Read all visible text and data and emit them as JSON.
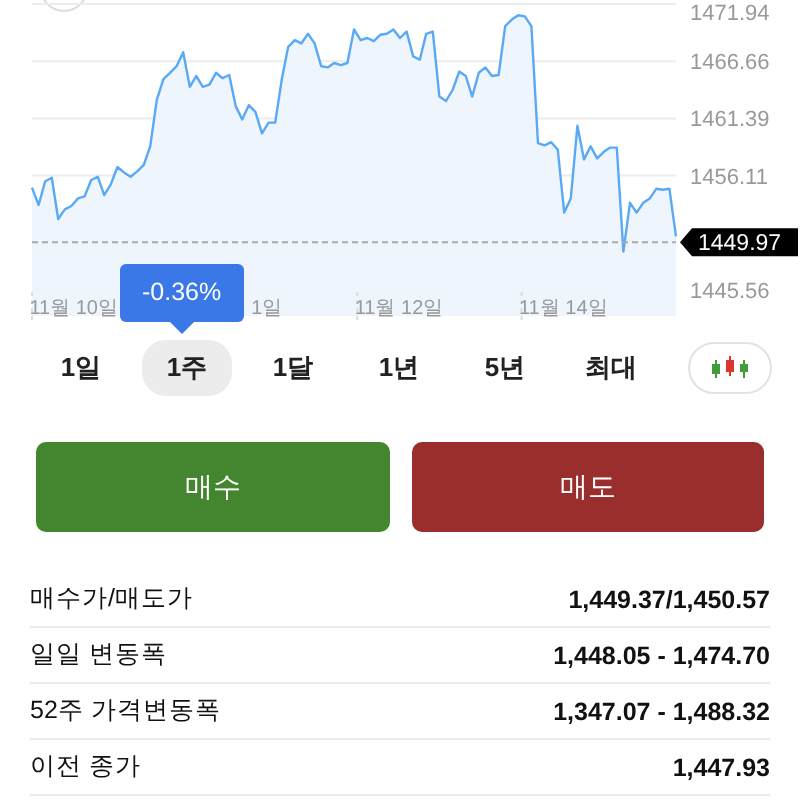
{
  "chart": {
    "tooltip": "-0.36%",
    "x_labels": [
      "11월 10일",
      "1일",
      "11월 12일",
      "11월 14일"
    ],
    "chart_data": {
      "type": "area",
      "grid": true,
      "series": [
        {
          "color": "#5aa9f5",
          "values": [
            1455.0,
            1453.4,
            1455.6,
            1455.9,
            1452.1,
            1453.0,
            1453.3,
            1454.0,
            1454.2,
            1455.7,
            1456.0,
            1454.3,
            1455.3,
            1456.9,
            1456.4,
            1456.0,
            1456.5,
            1457.1,
            1458.8,
            1463.1,
            1465.0,
            1465.6,
            1466.2,
            1467.5,
            1464.3,
            1465.3,
            1464.3,
            1464.5,
            1465.6,
            1465.1,
            1465.4,
            1462.5,
            1461.3,
            1462.6,
            1462.0,
            1460.0,
            1461.0,
            1461.0,
            1465.0,
            1468.0,
            1468.6,
            1468.3,
            1469.2,
            1468.3,
            1466.2,
            1466.1,
            1466.5,
            1466.3,
            1466.5,
            1469.6,
            1468.6,
            1468.8,
            1468.5,
            1469.1,
            1469.2,
            1469.6,
            1468.8,
            1469.4,
            1467.1,
            1466.8,
            1469.2,
            1469.4,
            1463.4,
            1463.0,
            1464.0,
            1465.7,
            1465.3,
            1463.4,
            1465.6,
            1466.1,
            1465.3,
            1465.4,
            1469.9,
            1470.5,
            1470.9,
            1470.8,
            1469.9,
            1459.1,
            1458.9,
            1459.2,
            1458.5,
            1452.7,
            1454.0,
            1460.7,
            1457.6,
            1458.8,
            1457.7,
            1458.3,
            1458.7,
            1458.7,
            1449.1,
            1453.6,
            1452.7,
            1453.6,
            1454.0,
            1454.9,
            1454.8,
            1454.9,
            1450.5
          ]
        }
      ],
      "ylim": [
        1445.56,
        1471.94
      ],
      "yticks": [
        {
          "value": 1471.94,
          "label": "1471.94"
        },
        {
          "value": 1466.66,
          "label": "1466.66"
        },
        {
          "value": 1461.39,
          "label": "1461.39"
        },
        {
          "value": 1456.11,
          "label": "1456.11"
        },
        {
          "value": 1445.56,
          "label": "1445.56"
        }
      ],
      "ref_lines": [
        {
          "axis": "y",
          "value": 1449.97,
          "label": "1449.97"
        }
      ]
    }
  },
  "periods": [
    {
      "label": "1일",
      "selected": false
    },
    {
      "label": "1주",
      "selected": true
    },
    {
      "label": "1달",
      "selected": false
    },
    {
      "label": "1년",
      "selected": false
    },
    {
      "label": "5년",
      "selected": false
    },
    {
      "label": "최대",
      "selected": false
    }
  ],
  "actions": [
    {
      "label": "매수",
      "kind": "buy"
    },
    {
      "label": "매도",
      "kind": "sell"
    }
  ],
  "stats": [
    {
      "label": "매수가/매도가",
      "value": "1,449.37/1,450.57"
    },
    {
      "label": "일일 변동폭",
      "value": "1,448.05 - 1,474.70"
    },
    {
      "label": "52주 가격변동폭",
      "value": "1,347.07 - 1,488.32"
    },
    {
      "label": "이전 종가",
      "value": "1,447.93"
    }
  ]
}
